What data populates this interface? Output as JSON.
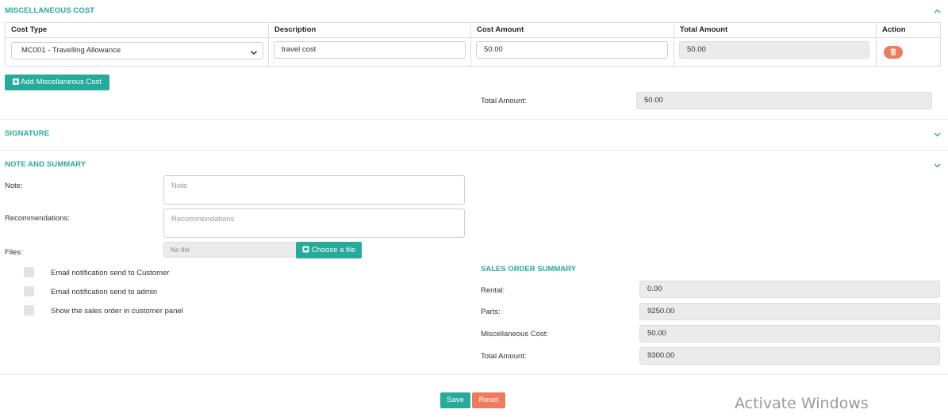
{
  "misc_cost": {
    "title": "MISCELLANEOUS COST",
    "headers": [
      "Cost Type",
      "Description",
      "Cost Amount",
      "Total Amount",
      "Action"
    ],
    "row": {
      "cost_type": "MC001 - Travelling Allowance",
      "description": "travel cost",
      "cost_amount": "50.00",
      "total_amount": "50.00"
    },
    "add_button": "Add Miscellaneous Cost",
    "total_label": "Total Amount:",
    "total_value": "50.00"
  },
  "signature": {
    "title": "SIGNATURE"
  },
  "note_summary": {
    "title": "NOTE AND SUMMARY",
    "note_label": "Note:",
    "note_placeholder": "Note",
    "recommendations_label": "Recommendations:",
    "recommendations_placeholder": "Recommendations",
    "files_label": "Files:",
    "file_value": "No file",
    "choose_file_button": "Choose a file",
    "checkboxes": [
      "Email notification send to Customer",
      "Email notification send to admin",
      "Show the sales order in customer panel"
    ]
  },
  "sales_summary": {
    "title": "SALES ORDER SUMMARY",
    "rental_label": "Rental:",
    "rental_value": "0.00",
    "parts_label": "Parts:",
    "parts_value": "9250.00",
    "misc_label": "Miscellaneous Cost:",
    "misc_value": "50.00",
    "total_label": "Total Amount:",
    "total_value": "9300.00"
  },
  "actions": {
    "save": "Save",
    "reset": "Reset"
  },
  "watermark": "Activate Windows",
  "colors": {
    "accent": "#26aa9c",
    "danger": "#f07a5e",
    "readonly": "#ebebeb"
  }
}
